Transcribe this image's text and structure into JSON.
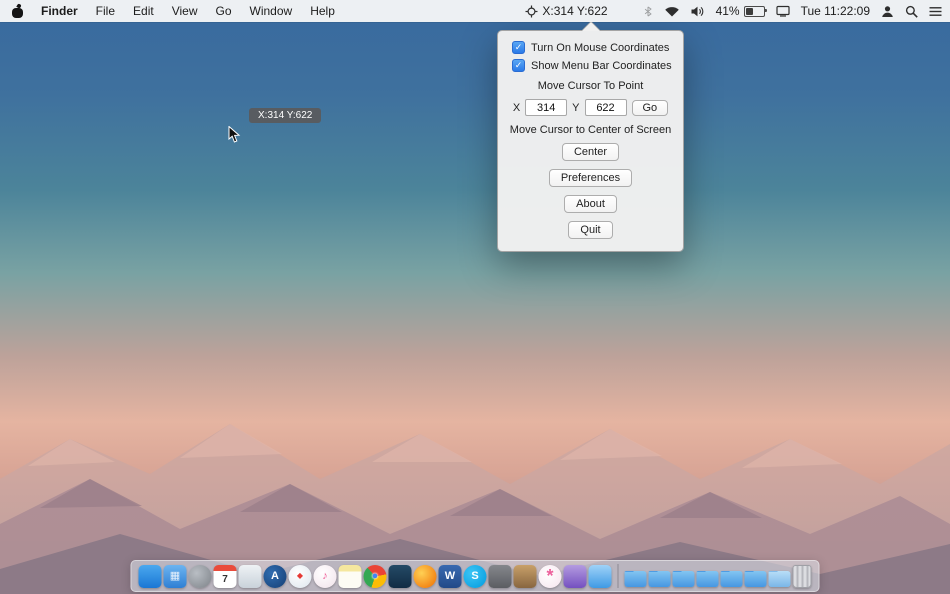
{
  "menu_bar": {
    "menus": [
      "Finder",
      "File",
      "Edit",
      "View",
      "Go",
      "Window",
      "Help"
    ],
    "coordinates": "X:314 Y:622",
    "battery_percent": "41%",
    "clock": "Tue 11:22:09"
  },
  "popover": {
    "checkmark": "✓",
    "checkbox_mouse": "Turn On Mouse Coordinates",
    "checkbox_menubar": "Show Menu Bar Coordinates",
    "move_point_title": "Move Cursor To Point",
    "x_label": "X",
    "x_value": "314",
    "y_label": "Y",
    "y_value": "622",
    "go_button": "Go",
    "center_title": "Move Cursor to Center of Screen",
    "center_button": "Center",
    "preferences_button": "Preferences",
    "about_button": "About",
    "quit_button": "Quit"
  },
  "tooltip": "X:314 Y:622",
  "dock": {
    "items": [
      {
        "name": "finder",
        "color": "linear-gradient(180deg,#4aa8ef,#1b77d4)",
        "glyph": "",
        "fg": "#ffffff"
      },
      {
        "name": "launchpad",
        "color": "linear-gradient(180deg,#6cb4f0,#2f7fd4)",
        "glyph": "▦",
        "fg": "#e8f2fc"
      },
      {
        "name": "dashboard",
        "color": "radial-gradient(circle at 35% 35%,#b9bec4,#7d8288)",
        "glyph": "",
        "fg": "#ffffff"
      },
      {
        "name": "calendar",
        "color": "linear-gradient(180deg,#e94b3c 0 26%,#ffffff 26%)",
        "glyph": "7",
        "fg": "#333333"
      },
      {
        "name": "mail",
        "color": "linear-gradient(180deg,#eef2f5,#c9d2da)",
        "glyph": "",
        "fg": "#5a7a9a"
      },
      {
        "name": "app-store",
        "color": "radial-gradient(circle at 35% 35%,#2f6cb0,#163f74)",
        "glyph": "A",
        "fg": "#ffffff"
      },
      {
        "name": "safari",
        "color": "radial-gradient(circle at 40% 35%,#ffffff,#dde6ee)",
        "glyph": "◆",
        "fg": "#e53935"
      },
      {
        "name": "itunes",
        "color": "radial-gradient(circle at 40% 35%,#ffffff,#f1e2ea)",
        "glyph": "♪",
        "fg": "#f0609a"
      },
      {
        "name": "notes",
        "color": "linear-gradient(180deg,#f5e79e 0 28%,#fdfcf4 28%)",
        "glyph": "",
        "fg": "#888888"
      },
      {
        "name": "chrome",
        "color": "conic-gradient(from -40deg,#ea4335 0 33%,#fbbc05 33% 66%,#34a853 66% 100%)",
        "glyph": "●",
        "fg": "#4285f4"
      },
      {
        "name": "navy-app",
        "color": "linear-gradient(180deg,#244a66,#122c44)",
        "glyph": "",
        "fg": "#ffffff"
      },
      {
        "name": "firefox",
        "color": "radial-gradient(circle at 35% 35%,#ffd054,#ef6c00)",
        "glyph": "",
        "fg": "#ffffff"
      },
      {
        "name": "word",
        "color": "linear-gradient(180deg,#3a6ab0,#234a88)",
        "glyph": "W",
        "fg": "#ffffff"
      },
      {
        "name": "skype",
        "color": "radial-gradient(circle at 35% 35%,#3cc5f5,#009ade)",
        "glyph": "S",
        "fg": "#ffffff"
      },
      {
        "name": "gray-app",
        "color": "linear-gradient(180deg,#85878c,#5b5d62)",
        "glyph": "",
        "fg": "#ffffff"
      },
      {
        "name": "brown-app",
        "color": "linear-gradient(180deg,#c8a069,#886640)",
        "glyph": "",
        "fg": "#ffffff"
      },
      {
        "name": "photos",
        "color": "radial-gradient(circle at 40% 40%,#ffffff,#f6e4ee)",
        "glyph": "*",
        "fg": "#ec5f9b"
      },
      {
        "name": "purple-box",
        "color": "linear-gradient(180deg,#b49be0,#7450c0)",
        "glyph": "",
        "fg": "#ffffff"
      },
      {
        "name": "blue-box",
        "color": "linear-gradient(180deg,#9fd2f8,#3f9ae4)",
        "glyph": "",
        "fg": "#ffffff"
      }
    ],
    "folders": [
      {
        "name": "folder",
        "color": "linear-gradient(180deg,#83c5f2,#4697e2)"
      },
      {
        "name": "folder",
        "color": "linear-gradient(180deg,#83c5f2,#4697e2)"
      },
      {
        "name": "folder",
        "color": "linear-gradient(180deg,#83c5f2,#4697e2)"
      },
      {
        "name": "folder",
        "color": "linear-gradient(180deg,#83c5f2,#4697e2)"
      },
      {
        "name": "folder",
        "color": "linear-gradient(180deg,#83c5f2,#4697e2)"
      },
      {
        "name": "folder",
        "color": "linear-gradient(180deg,#83c5f2,#4697e2)"
      },
      {
        "name": "downloads-folder",
        "color": "linear-gradient(180deg,#b9def7,#7ab6e8)"
      }
    ]
  },
  "colors": {
    "accent": "#2b7ae8",
    "menubar_bg": "#f9f9f9",
    "popover_bg": "#f0f0f0",
    "tooltip_bg": "#5a5a5c"
  }
}
